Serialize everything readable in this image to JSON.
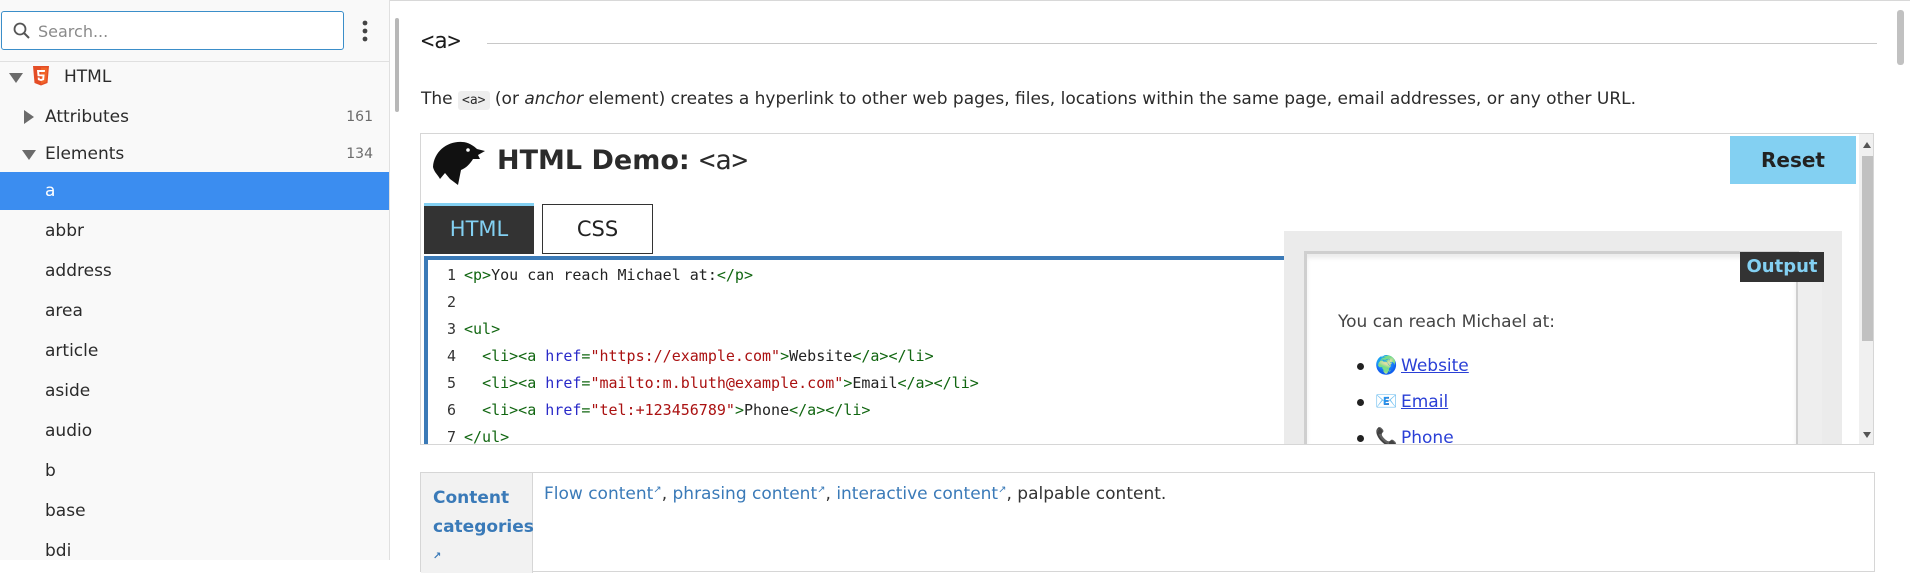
{
  "sidebar": {
    "search_placeholder": "Search...",
    "root": {
      "label": "HTML"
    },
    "groups": [
      {
        "label": "Attributes",
        "count": "161"
      },
      {
        "label": "Elements",
        "count": "134"
      }
    ],
    "elements": [
      "a",
      "abbr",
      "address",
      "area",
      "article",
      "aside",
      "audio",
      "b",
      "base",
      "bdi"
    ],
    "selected": "a"
  },
  "page": {
    "title": "<a>",
    "intro": {
      "pre": "The ",
      "code": "<a>",
      "mid": " (or ",
      "em": "anchor",
      "post": " element) creates a hyperlink to other web pages, files, locations within the same page, email addresses, or any other URL."
    }
  },
  "demo": {
    "title_prefix": "HTML Demo: ",
    "title_tag": "<a>",
    "reset_label": "Reset",
    "tabs": [
      "HTML",
      "CSS"
    ],
    "active_tab": "HTML",
    "code_lines": [
      {
        "n": "1",
        "parts": [
          [
            "t",
            "<p>"
          ],
          [
            "x",
            "You can reach Michael at:"
          ],
          [
            "t",
            "</p>"
          ]
        ]
      },
      {
        "n": "2",
        "parts": []
      },
      {
        "n": "3",
        "parts": [
          [
            "t",
            "<ul>"
          ]
        ]
      },
      {
        "n": "4",
        "parts": [
          [
            "x",
            "  "
          ],
          [
            "t",
            "<li><a "
          ],
          [
            "a",
            "href"
          ],
          [
            "t",
            "="
          ],
          [
            "s",
            "\"https://example.com\""
          ],
          [
            "t",
            ">"
          ],
          [
            "x",
            "Website"
          ],
          [
            "t",
            "</a></li>"
          ]
        ]
      },
      {
        "n": "5",
        "parts": [
          [
            "x",
            "  "
          ],
          [
            "t",
            "<li><a "
          ],
          [
            "a",
            "href"
          ],
          [
            "t",
            "="
          ],
          [
            "s",
            "\"mailto:m.bluth@example.com\""
          ],
          [
            "t",
            ">"
          ],
          [
            "x",
            "Email"
          ],
          [
            "t",
            "</a></li>"
          ]
        ]
      },
      {
        "n": "6",
        "parts": [
          [
            "x",
            "  "
          ],
          [
            "t",
            "<li><a "
          ],
          [
            "a",
            "href"
          ],
          [
            "t",
            "="
          ],
          [
            "s",
            "\"tel:+123456789\""
          ],
          [
            "t",
            ">"
          ],
          [
            "x",
            "Phone"
          ],
          [
            "t",
            "</a></li>"
          ]
        ]
      },
      {
        "n": "7",
        "parts": [
          [
            "t",
            "</ul>"
          ]
        ]
      }
    ],
    "output": {
      "badge": "Output",
      "text": "You can reach Michael at:",
      "links": [
        {
          "icon": "🌍",
          "icon_name": "globe-icon",
          "label": "Website"
        },
        {
          "icon": "📧",
          "icon_name": "envelope-icon",
          "label": "Email"
        },
        {
          "icon": "📞",
          "icon_name": "phone-icon",
          "label": "Phone"
        }
      ]
    }
  },
  "content_categories": {
    "title": "Content categories",
    "links": [
      "Flow content",
      "phrasing content",
      "interactive content"
    ],
    "tail": ", palpable content."
  },
  "colors": {
    "selected_bg": "#3b8df0",
    "accent_blue": "#83d0f2",
    "link_blue": "#3a7ab8",
    "editor_border": "#3b7ab7"
  }
}
